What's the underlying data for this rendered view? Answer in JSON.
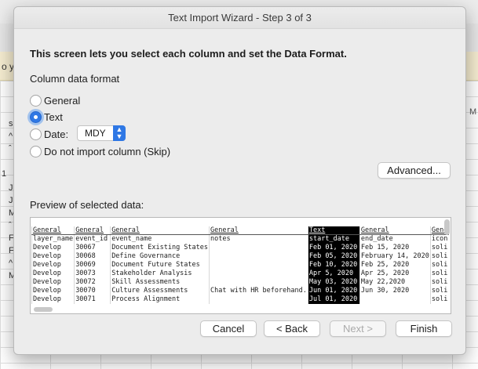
{
  "background": {
    "banner_text": "o yo",
    "left_cells": [
      "s",
      "^",
      "ˆ",
      "1",
      "J",
      "J",
      "M",
      "ˆ",
      "F",
      "F",
      "^",
      "M"
    ],
    "column_m": "M"
  },
  "dialog": {
    "title": "Text Import Wizard - Step 3 of 3",
    "intro": "This screen lets you select each column and set the Data Format.",
    "format_heading": "Column data format",
    "options": {
      "general": "General",
      "text": "Text",
      "date": "Date:",
      "skip": "Do not import column (Skip)"
    },
    "selected_option": "Text",
    "date_format": "MDY",
    "advanced_label": "Advanced...",
    "preview_label": "Preview of selected data:",
    "preview": {
      "headers": [
        "General",
        "General",
        "General",
        "General",
        "Text",
        "General",
        "Gene"
      ],
      "rows": [
        [
          "layer_name",
          "event_id",
          "event_name",
          "notes",
          "start_date",
          "end_date",
          "icon"
        ],
        [
          "Develop",
          "30067",
          "Document Existing States",
          "",
          "Feb 01, 2020",
          "Feb 15, 2020",
          "soli"
        ],
        [
          "Develop",
          "30068",
          "Define Governance",
          "",
          "Feb 05, 2020",
          "February 14, 2020",
          "soli"
        ],
        [
          "Develop",
          "30069",
          "Document Future States",
          "",
          "Feb 10, 2020",
          "Feb 25, 2020",
          "soli"
        ],
        [
          "Develop",
          "30073",
          "Stakeholder Analysis",
          "",
          "Apr 5, 2020",
          "Apr 25, 2020",
          "soli"
        ],
        [
          "Develop",
          "30072",
          "Skill Assessments",
          "",
          "May 03, 2020",
          "May 22,2020",
          "soli"
        ],
        [
          "Develop",
          "30070",
          "Culture Assessments",
          "Chat with HR beforehand.",
          "Jun 01, 2020",
          "Jun 30, 2020",
          "soli"
        ],
        [
          "Develop",
          "30071",
          "Process Alignment",
          "",
          "Jul 01, 2020",
          "",
          "soli"
        ]
      ]
    },
    "buttons": {
      "cancel": "Cancel",
      "back": "< Back",
      "next": "Next >",
      "finish": "Finish"
    },
    "colors": {
      "accent": "#2f78e5",
      "selected_column_bg": "#000000"
    }
  }
}
